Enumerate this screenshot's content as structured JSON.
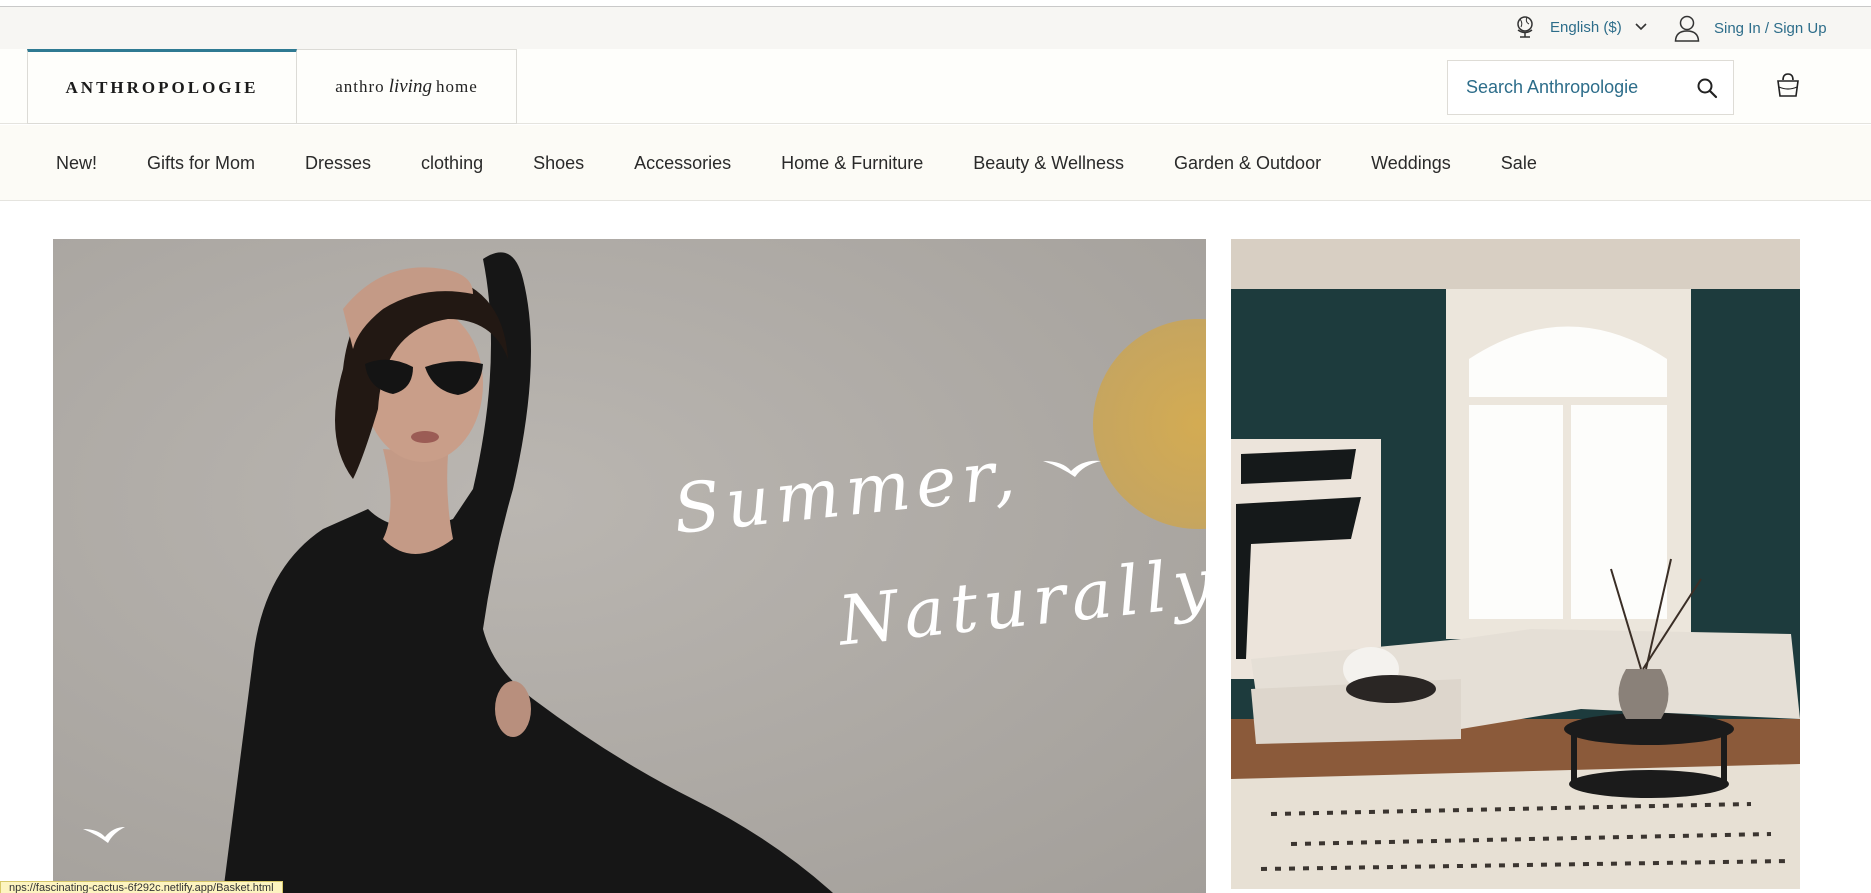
{
  "utility": {
    "language": "English ($)",
    "sign_in": "Sing In / Sign Up"
  },
  "header": {
    "brand_primary": "ANTHROPOLOGIE",
    "brand_secondary_left": "anthro",
    "brand_secondary_script": "living",
    "brand_secondary_right": "home",
    "search_placeholder": "Search Anthropologie"
  },
  "nav": {
    "items": [
      "New!",
      "Gifts for Mom",
      "Dresses",
      "clothing",
      "Shoes",
      "Accessories",
      "Home & Furniture",
      "Beauty & Wellness",
      "Garden & Outdoor",
      "Weddings",
      "Sale"
    ]
  },
  "hero": {
    "line1": "Summer,",
    "line2": "Naturally"
  },
  "status_bar": {
    "url": "nps://fascinating-cactus-6f292c.netlify.app/Basket.html"
  },
  "colors": {
    "accent": "#2d6d8a",
    "brand_bar": "#2f7a92",
    "utility_bg": "#f7f6f3",
    "nav_bg": "#fcfbf6"
  },
  "icons": {
    "globe": "globe-icon",
    "chevron": "chevron-down-icon",
    "user": "user-icon",
    "search": "search-icon",
    "bag": "shopping-bag-icon"
  }
}
